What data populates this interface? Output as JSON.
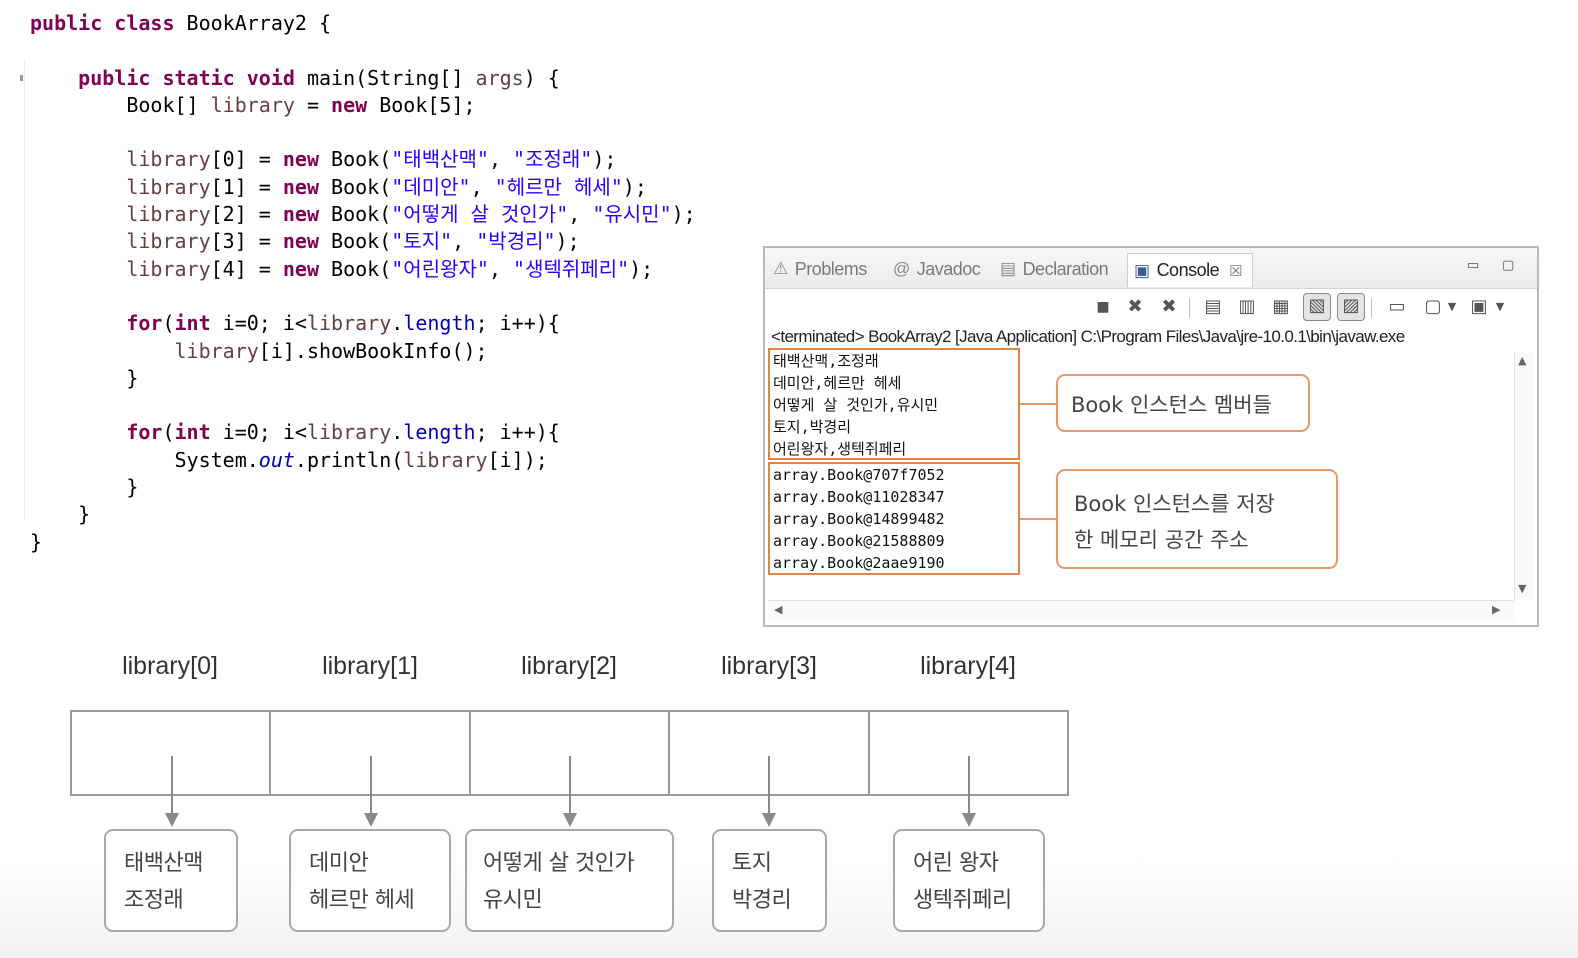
{
  "code": [
    [
      {
        "t": "public class ",
        "c": "k"
      },
      {
        "t": "BookArray2 {"
      }
    ],
    [],
    [
      {
        "t": "    "
      },
      {
        "t": "public static void ",
        "c": "k"
      },
      {
        "t": "main(String[] "
      },
      {
        "t": "args",
        "c": "v"
      },
      {
        "t": ") {"
      }
    ],
    [
      {
        "t": "        Book[] "
      },
      {
        "t": "library",
        "c": "v"
      },
      {
        "t": " = "
      },
      {
        "t": "new ",
        "c": "k"
      },
      {
        "t": "Book[5];"
      }
    ],
    [],
    [
      {
        "t": "        "
      },
      {
        "t": "library",
        "c": "v"
      },
      {
        "t": "[0] = "
      },
      {
        "t": "new ",
        "c": "k"
      },
      {
        "t": "Book("
      },
      {
        "t": "\"태백산맥\"",
        "c": "s"
      },
      {
        "t": ", "
      },
      {
        "t": "\"조정래\"",
        "c": "s"
      },
      {
        "t": ");"
      }
    ],
    [
      {
        "t": "        "
      },
      {
        "t": "library",
        "c": "v"
      },
      {
        "t": "[1] = "
      },
      {
        "t": "new ",
        "c": "k"
      },
      {
        "t": "Book("
      },
      {
        "t": "\"데미안\"",
        "c": "s"
      },
      {
        "t": ", "
      },
      {
        "t": "\"헤르만 헤세\"",
        "c": "s"
      },
      {
        "t": ");"
      }
    ],
    [
      {
        "t": "        "
      },
      {
        "t": "library",
        "c": "v"
      },
      {
        "t": "[2] = "
      },
      {
        "t": "new ",
        "c": "k"
      },
      {
        "t": "Book("
      },
      {
        "t": "\"어떻게 살 것인가\"",
        "c": "s"
      },
      {
        "t": ", "
      },
      {
        "t": "\"유시민\"",
        "c": "s"
      },
      {
        "t": ");"
      }
    ],
    [
      {
        "t": "        "
      },
      {
        "t": "library",
        "c": "v"
      },
      {
        "t": "[3] = "
      },
      {
        "t": "new ",
        "c": "k"
      },
      {
        "t": "Book("
      },
      {
        "t": "\"토지\"",
        "c": "s"
      },
      {
        "t": ", "
      },
      {
        "t": "\"박경리\"",
        "c": "s"
      },
      {
        "t": ");"
      }
    ],
    [
      {
        "t": "        "
      },
      {
        "t": "library",
        "c": "v"
      },
      {
        "t": "[4] = "
      },
      {
        "t": "new ",
        "c": "k"
      },
      {
        "t": "Book("
      },
      {
        "t": "\"어린왕자\"",
        "c": "s"
      },
      {
        "t": ", "
      },
      {
        "t": "\"생텍쥐페리\"",
        "c": "s"
      },
      {
        "t": ");"
      }
    ],
    [],
    [
      {
        "t": "        "
      },
      {
        "t": "for",
        "c": "k"
      },
      {
        "t": "("
      },
      {
        "t": "int ",
        "c": "k"
      },
      {
        "t": "i=0; i<"
      },
      {
        "t": "library",
        "c": "v"
      },
      {
        "t": "."
      },
      {
        "t": "length",
        "c": "f"
      },
      {
        "t": "; i++){"
      }
    ],
    [
      {
        "t": "            "
      },
      {
        "t": "library",
        "c": "v"
      },
      {
        "t": "[i].showBookInfo();"
      }
    ],
    [
      {
        "t": "        }"
      }
    ],
    [],
    [
      {
        "t": "        "
      },
      {
        "t": "for",
        "c": "k"
      },
      {
        "t": "("
      },
      {
        "t": "int ",
        "c": "k"
      },
      {
        "t": "i=0; i<"
      },
      {
        "t": "library",
        "c": "v"
      },
      {
        "t": "."
      },
      {
        "t": "length",
        "c": "f"
      },
      {
        "t": "; i++){"
      }
    ],
    [
      {
        "t": "            System."
      },
      {
        "t": "out",
        "c": "fi"
      },
      {
        "t": ".println("
      },
      {
        "t": "library",
        "c": "v"
      },
      {
        "t": "[i]);"
      }
    ],
    [
      {
        "t": "        }"
      }
    ],
    [
      {
        "t": "    }"
      }
    ],
    [
      {
        "t": "}"
      }
    ]
  ],
  "console": {
    "tabs": [
      {
        "label": "Problems",
        "icon": "problems-icon",
        "glyph": "⚠"
      },
      {
        "label": "Javadoc",
        "icon": "at-icon",
        "glyph": "@"
      },
      {
        "label": "Declaration",
        "icon": "declaration-icon",
        "glyph": "▤"
      },
      {
        "label": "Console",
        "icon": "console-icon",
        "glyph": "▣"
      }
    ],
    "close_glyph": "☒",
    "minimize_glyph": "▭",
    "maximize_glyph": "▢",
    "status": "<terminated> BookArray2 [Java Application] C:\\Program Files\\Java\\jre-10.0.1\\bin\\javaw.exe",
    "output_members": [
      "태백산맥,조정래",
      "데미안,헤르만 헤세",
      "어떻게 살 것인가,유시민",
      "토지,박경리",
      "어린왕자,생텍쥐페리"
    ],
    "output_addresses": [
      "array.Book@707f7052",
      "array.Book@11028347",
      "array.Book@14899482",
      "array.Book@21588809",
      "array.Book@2aae9190"
    ],
    "callout_members": "Book 인스턴스 멤버들",
    "callout_address_line1": "Book 인스턴스를 저장",
    "callout_address_line2": "한 메모리 공간 주소"
  },
  "diagram": {
    "labels": [
      "library[0]",
      "library[1]",
      "library[2]",
      "library[3]",
      "library[4]"
    ],
    "books": [
      {
        "title": "태백산맥",
        "author": "조정래"
      },
      {
        "title": "데미안",
        "author": "헤르만 헤세"
      },
      {
        "title": "어떻게 살 것인가",
        "author": "유시민"
      },
      {
        "title": "토지",
        "author": "박경리"
      },
      {
        "title": "어린 왕자",
        "author": "생텍쥐페리"
      }
    ]
  }
}
